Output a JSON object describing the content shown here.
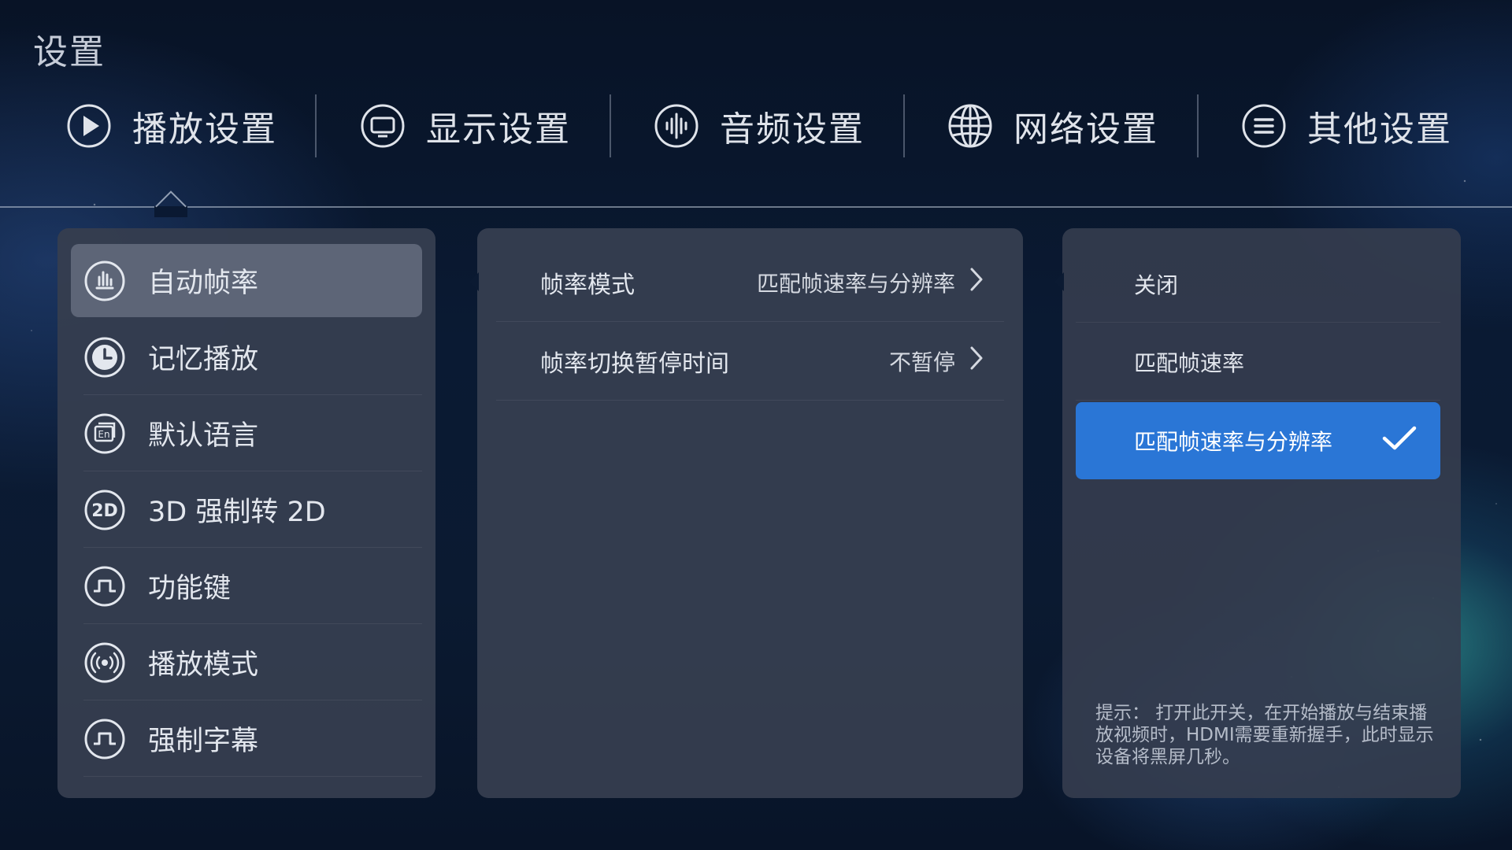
{
  "page_title": "设置",
  "tabs": [
    {
      "label": "播放设置",
      "icon": "play-icon",
      "selected": true
    },
    {
      "label": "显示设置",
      "icon": "monitor-icon"
    },
    {
      "label": "音频设置",
      "icon": "audio-wave-icon"
    },
    {
      "label": "网络设置",
      "icon": "globe-icon"
    },
    {
      "label": "其他设置",
      "icon": "menu-icon"
    }
  ],
  "left_menu": [
    {
      "label": "自动帧率",
      "icon": "bar-chart-icon",
      "selected": true
    },
    {
      "label": "记忆播放",
      "icon": "clock-icon"
    },
    {
      "label": "默认语言",
      "icon": "language-en-icon"
    },
    {
      "label": "3D 强制转 2D",
      "icon": "2d-icon"
    },
    {
      "label": "功能键",
      "icon": "pulse-icon"
    },
    {
      "label": "播放模式",
      "icon": "broadcast-icon"
    },
    {
      "label": "强制字幕",
      "icon": "pulse-icon"
    }
  ],
  "settings": [
    {
      "label": "帧率模式",
      "value": "匹配帧速率与分辨率"
    },
    {
      "label": "帧率切换暂停时间",
      "value": "不暂停"
    }
  ],
  "options": [
    {
      "label": "关闭"
    },
    {
      "label": "匹配帧速率"
    },
    {
      "label": "匹配帧速率与分辨率",
      "selected": true
    }
  ],
  "hint": "提示： 打开此开关，在开始播放与结束播放视频时，HDMI需要重新握手，此时显示设备将黑屏几秒。",
  "colors": {
    "accent": "#2a76d6",
    "panel": "#353d4f",
    "selected_item": "#5d6577",
    "background": "#0a1a33"
  }
}
